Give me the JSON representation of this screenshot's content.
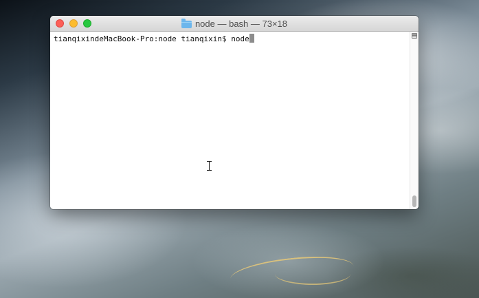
{
  "window": {
    "title": "node — bash — 73×18",
    "folder_icon": "folder-icon"
  },
  "terminal": {
    "prompt": "tianqixindeMacBook-Pro:node tianqixin$ ",
    "command": "node"
  },
  "scrollbar": {
    "position_fraction": 1.0
  },
  "colors": {
    "close": "#fc5f57",
    "minimize": "#fdbc2e",
    "maximize": "#28c840",
    "folder": "#6cb6ec"
  }
}
